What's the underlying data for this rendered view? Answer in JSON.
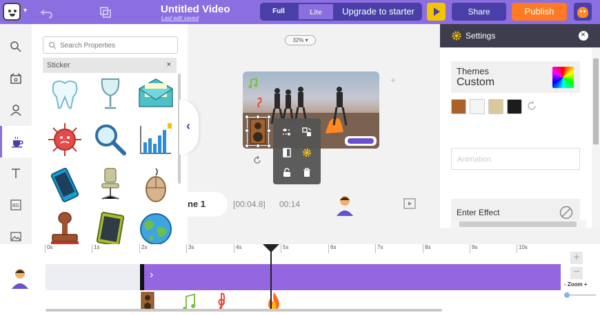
{
  "header": {
    "title": "Untitled Video",
    "subtitle": "Last edit saved",
    "view_full": "Full",
    "view_lite": "Lite",
    "upgrade": "Upgrade to starter",
    "share": "Share",
    "publish": "Publish"
  },
  "sidebar": {
    "items": [
      {
        "name": "search-icon"
      },
      {
        "name": "scenes-icon"
      },
      {
        "name": "character-icon"
      },
      {
        "name": "props-icon",
        "active": true
      },
      {
        "name": "text-icon"
      },
      {
        "name": "background-icon",
        "label": "BG"
      },
      {
        "name": "image-icon"
      }
    ]
  },
  "properties": {
    "search_placeholder": "Search Properties",
    "tag": "Sticker",
    "tag_remove": "×",
    "stickers": [
      "tooth",
      "wine-glass",
      "envelope",
      "virus",
      "magnifying-glass",
      "bar-chart",
      "smartphone",
      "office-chair",
      "computer-mouse",
      "stamp",
      "tablet",
      "globe"
    ]
  },
  "canvas": {
    "zoom": "32%",
    "context_menu": [
      "split-icon",
      "swap-icon",
      "layer-icon",
      "settings-icon",
      "unlock-icon",
      "delete-icon"
    ]
  },
  "scene": {
    "name": "ne 1",
    "timestamp": "[00:04.8]",
    "duration": "00:14"
  },
  "settings": {
    "title": "Settings",
    "themes_label": "Themes",
    "themes_value": "Custom",
    "swatches": [
      "#a8622b",
      "#f5f5f5",
      "#d9c99a",
      "#1c1c1c"
    ],
    "animation_placeholder": "Animation",
    "enter_effect": "Enter Effect"
  },
  "timeline": {
    "ticks": [
      "0s",
      "1s",
      "2s",
      "3s",
      "4s",
      "5s",
      "6s",
      "7s",
      "8s",
      "9s",
      "10s"
    ],
    "zoom_label": "- Zoom +",
    "zoom_plus": "+",
    "zoom_minus": "−",
    "layers": [
      "speaker",
      "music-note",
      "treble-clef",
      "fire"
    ]
  },
  "colors": {
    "brand": "#8b6fe0",
    "dark": "#4a3fa8",
    "publish": "#ff7a22",
    "play": "#f5c400"
  }
}
